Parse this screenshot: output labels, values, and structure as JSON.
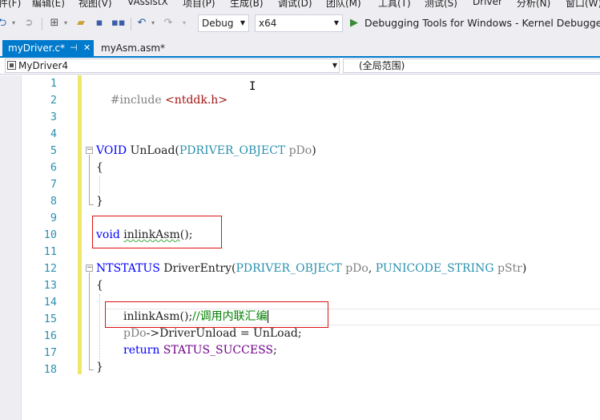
{
  "menu": {
    "items": [
      "件(F)",
      "编辑(E)",
      "视图(V)",
      "VAssistX",
      "项目(P)",
      "生成(B)",
      "调试(D)",
      "团队(M)",
      "工具(T)",
      "测试(S)",
      "Driver",
      "分析(N)",
      "窗口(W)"
    ]
  },
  "toolbar": {
    "config_value": "Debug",
    "platform_value": "x64",
    "debugger_label": "Debugging Tools for Windows - Kernel Debugger"
  },
  "tabs": [
    {
      "label": "myDriver.c*",
      "active": true
    },
    {
      "label": "myAsm.asm*",
      "active": false
    }
  ],
  "navbar": {
    "project": "MyDriver4",
    "scope": "(全局范围)"
  },
  "editor": {
    "line_numbers": [
      "1",
      "2",
      "3",
      "4",
      "5",
      "6",
      "7",
      "8",
      "9",
      "10",
      "11",
      "12",
      "13",
      "14",
      "15",
      "16",
      "17",
      "18"
    ],
    "line1": {
      "directive": "#include",
      "header": "<ntddk.h>"
    },
    "line5": {
      "ret": "VOID",
      "name": "UnLoad",
      "open": "(",
      "ptype": "PDRIVER_OBJECT",
      "pname": "pDo",
      "close": ")"
    },
    "line6": "{",
    "line8": "}",
    "line10": {
      "ret": "void",
      "name": "inlinkAsm",
      "rest": "();"
    },
    "line12": {
      "ret": "NTSTATUS",
      "name": "DriverEntry",
      "open": "(",
      "ptype1": "PDRIVER_OBJECT",
      "pname1": "pDo",
      "comma": ", ",
      "ptype2": "PUNICODE_STRING",
      "pname2": "pStr",
      "close": ")"
    },
    "line13": "{",
    "line15": {
      "call": "inlinkAsm();",
      "comment": "//调用内联汇编"
    },
    "line16": {
      "obj": "pDo",
      "rest": "->DriverUnload = UnLoad;"
    },
    "line17": {
      "kw": "return",
      "value": "STATUS_SUCCESS",
      "semi": ";"
    },
    "line18": "}"
  }
}
